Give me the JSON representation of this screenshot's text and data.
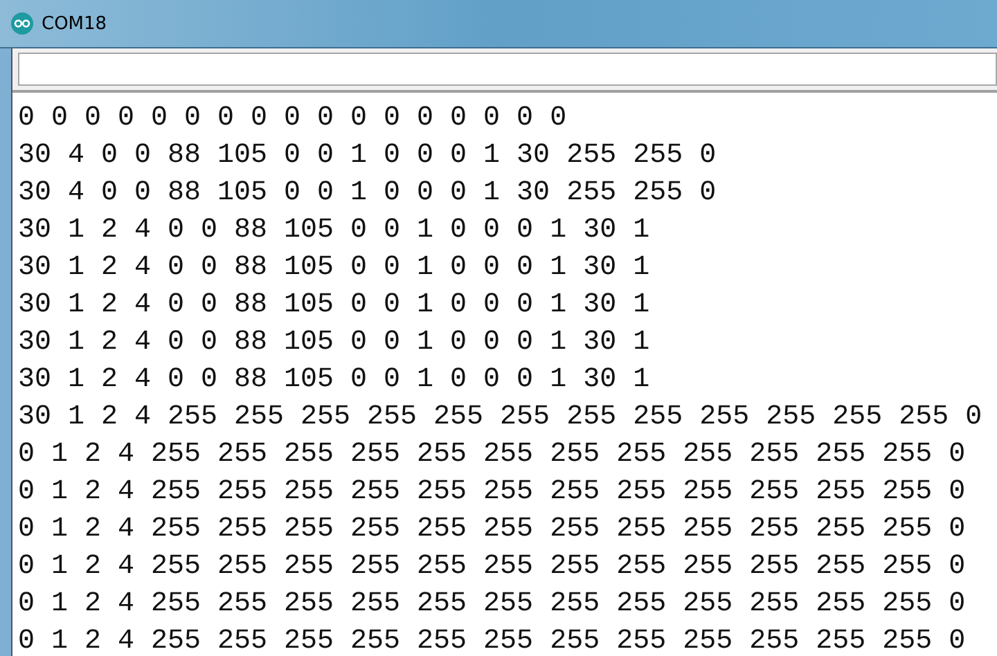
{
  "window": {
    "title": "COM18"
  },
  "output": {
    "lines": [
      "0 0 0 0 0 0 0 0 0 0 0 0 0 0 0 0 0",
      "30 4 0 0 88 105 0 0 1 0 0 0 1 30 255 255 0",
      "30 4 0 0 88 105 0 0 1 0 0 0 1 30 255 255 0",
      "30 1 2 4 0 0 88 105 0 0 1 0 0 0 1 30 1",
      "30 1 2 4 0 0 88 105 0 0 1 0 0 0 1 30 1",
      "30 1 2 4 0 0 88 105 0 0 1 0 0 0 1 30 1",
      "30 1 2 4 0 0 88 105 0 0 1 0 0 0 1 30 1",
      "30 1 2 4 0 0 88 105 0 0 1 0 0 0 1 30 1",
      "30 1 2 4 255 255 255 255 255 255 255 255 255 255 255 255 0",
      "0 1 2 4 255 255 255 255 255 255 255 255 255 255 255 255 0",
      "0 1 2 4 255 255 255 255 255 255 255 255 255 255 255 255 0",
      "0 1 2 4 255 255 255 255 255 255 255 255 255 255 255 255 0",
      "0 1 2 4 255 255 255 255 255 255 255 255 255 255 255 255 0",
      "0 1 2 4 255 255 255 255 255 255 255 255 255 255 255 255 0",
      "0 1 2 4 255 255 255 255 255 255 255 255 255 255 255 255 0"
    ]
  }
}
